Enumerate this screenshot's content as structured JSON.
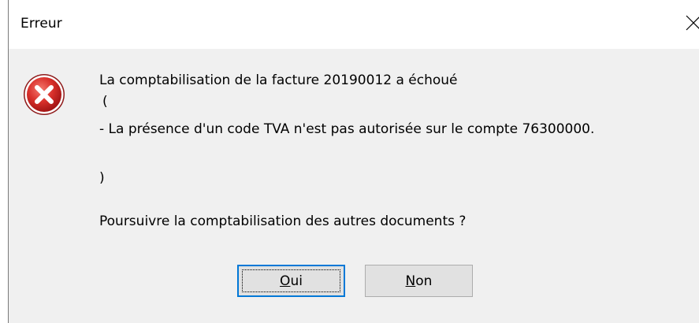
{
  "window": {
    "title": "Erreur"
  },
  "message": {
    "line1": "La comptabilisation de la facture 20190012 a échoué",
    "line2": "(",
    "line3": "- La présence d'un code TVA n'est pas autorisée sur le compte 76300000.",
    "line4": ")",
    "question": "Poursuivre la comptabilisation des autres documents ?"
  },
  "buttons": {
    "yes": {
      "mnemonic": "O",
      "rest": "ui"
    },
    "no": {
      "mnemonic": "N",
      "rest": "on"
    }
  },
  "icons": {
    "error": "error-icon",
    "close": "close-icon"
  },
  "colors": {
    "error_red": "#d32f2f",
    "default_button_border": "#0078d7"
  }
}
